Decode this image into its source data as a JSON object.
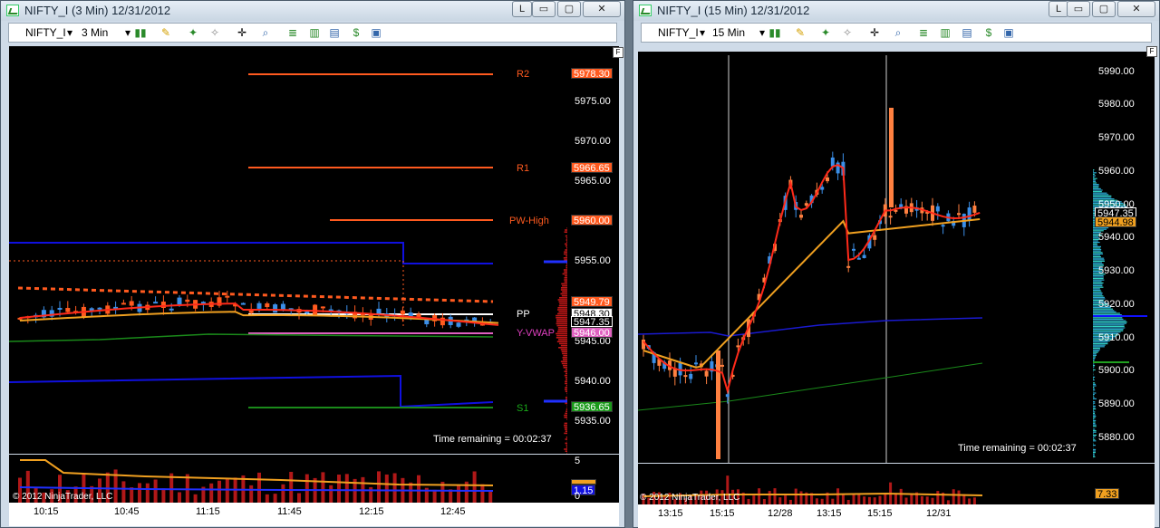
{
  "left": {
    "title": "NIFTY_I (3 Min)  12/31/2012",
    "symbol": "NIFTY_I",
    "period": "3 Min",
    "buttons": {
      "restore": "L",
      "min": "▭",
      "max": "▢",
      "close": "✕"
    },
    "y_labels": [
      "5975.00",
      "5970.00",
      "5965.00",
      "5955.00",
      "5945.00",
      "5940.00",
      "5935.00"
    ],
    "x_labels": [
      "10:15",
      "10:45",
      "11:15",
      "11:45",
      "12:15",
      "12:45"
    ],
    "level_labels": {
      "r2": "R2",
      "r1": "R1",
      "pwhigh": "PW-High",
      "pp": "PP",
      "yvwap": "Y-VWAP",
      "s1": "S1"
    },
    "tags": {
      "r2": "5978.30",
      "r1": "5966.65",
      "pwhigh": "5960.00",
      "ema": "5949.79",
      "pp": "5948.30",
      "last": "5947.35",
      "yvwap": "5946.00",
      "s1": "5936.65"
    },
    "volume_labels": {
      "top": "5",
      "mid": "1.15",
      "bottom": "0"
    },
    "remaining": "Time remaining = 00:02:37",
    "copyright": "© 2012 NinjaTrader, LLC",
    "f_button": "F",
    "colors": {
      "up": "#3b8fe8",
      "down": "#ff5a1f",
      "ema": "#ff2a1a",
      "vwap": "#f0a020",
      "blue": "#1010e0",
      "green": "#1a8a1a"
    }
  },
  "right": {
    "title": "NIFTY_I (15 Min)  12/31/2012",
    "symbol": "NIFTY_I",
    "period": "15 Min",
    "buttons": {
      "restore": "L",
      "min": "▭",
      "max": "▢",
      "close": "✕"
    },
    "y_labels": [
      "5990.00",
      "5980.00",
      "5970.00",
      "5960.00",
      "5950.00",
      "5940.00",
      "5930.00",
      "5920.00",
      "5910.00",
      "5900.00",
      "5890.00",
      "5880.00"
    ],
    "x_labels": [
      "13:15",
      "15:15",
      "12/28",
      "13:15",
      "15:15",
      "12/31"
    ],
    "tags": {
      "last": "5947.35",
      "vwap": "5944.98",
      "volume": "7.33"
    },
    "remaining": "Time remaining = 00:02:37",
    "copyright": "© 2012 NinjaTrader, LLC",
    "f_button": "F"
  }
}
